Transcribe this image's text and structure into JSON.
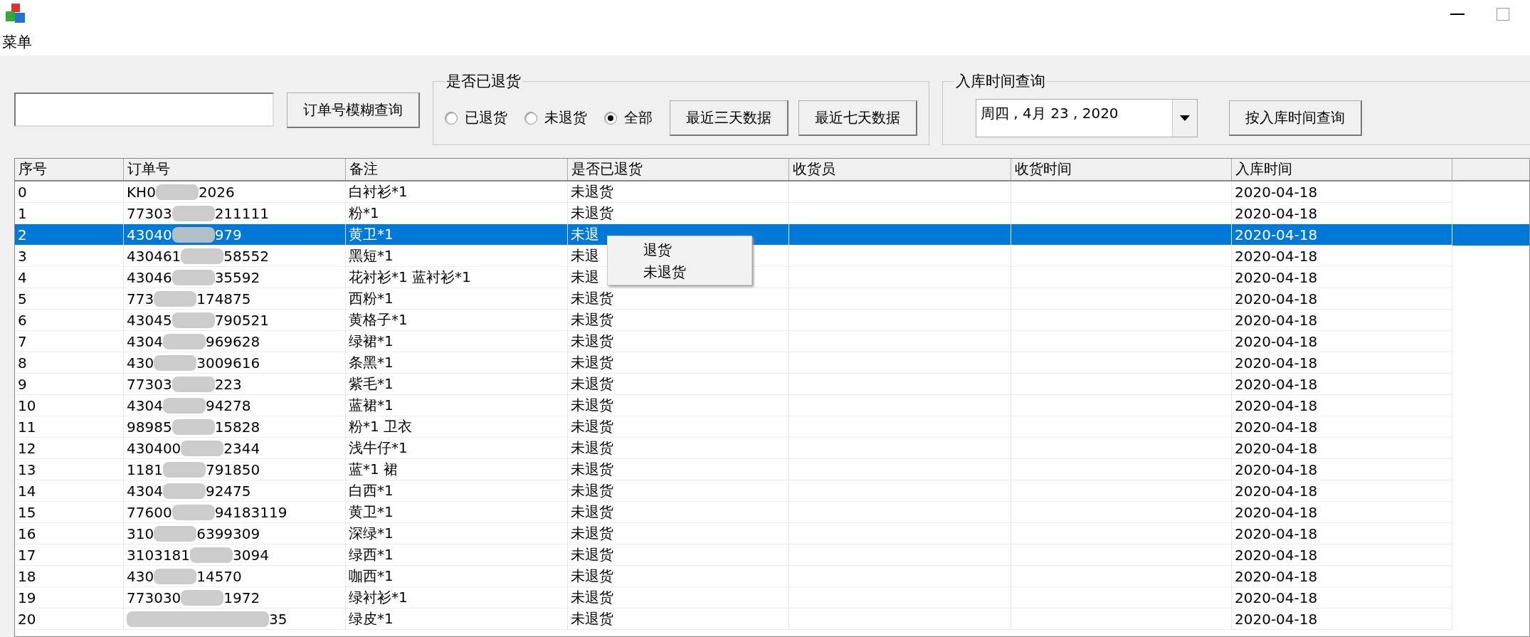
{
  "menu": "菜单",
  "fuzzy_button": "订单号模糊查询",
  "return_group": {
    "title": "是否已退货",
    "radios": [
      {
        "label": "已退货",
        "selected": false
      },
      {
        "label": "未退货",
        "selected": false
      },
      {
        "label": "全部",
        "selected": true
      }
    ],
    "buttons": [
      "最近三天数据",
      "最近七天数据"
    ]
  },
  "date_group": {
    "title": "入库时间查询",
    "date": "周四 , 4月  23 , 2020",
    "button": "按入库时间查询"
  },
  "table": {
    "columns": [
      "序号",
      "订单号",
      "备注",
      "是否已退货",
      "收货员",
      "收货时间",
      "入库时间"
    ],
    "rows": [
      {
        "cells": [
          "0",
          [
            "KH0",
            "2026"
          ],
          "白衬衫*1",
          "未退货",
          "",
          "",
          "2020-04-18"
        ],
        "selected": false
      },
      {
        "cells": [
          "1",
          [
            "77303",
            "211111"
          ],
          "粉*1",
          "未退货",
          "",
          "",
          "2020-04-18"
        ],
        "selected": false
      },
      {
        "cells": [
          "2",
          [
            "43040",
            "979"
          ],
          "黄卫*1",
          "未退",
          "",
          "",
          "2020-04-18"
        ],
        "selected": true
      },
      {
        "cells": [
          "3",
          [
            "430461",
            "58552"
          ],
          "黑短*1",
          "未退",
          "",
          "",
          "2020-04-18"
        ],
        "selected": false
      },
      {
        "cells": [
          "4",
          [
            "43046",
            "35592"
          ],
          "花衬衫*1 蓝衬衫*1",
          "未退",
          "",
          "",
          "2020-04-18"
        ],
        "selected": false
      },
      {
        "cells": [
          "5",
          [
            "773",
            "174875"
          ],
          "西粉*1",
          "未退货",
          "",
          "",
          "2020-04-18"
        ],
        "selected": false
      },
      {
        "cells": [
          "6",
          [
            "43045",
            "790521"
          ],
          "黄格子*1",
          "未退货",
          "",
          "",
          "2020-04-18"
        ],
        "selected": false
      },
      {
        "cells": [
          "7",
          [
            "4304",
            "969628"
          ],
          "绿裙*1",
          "未退货",
          "",
          "",
          "2020-04-18"
        ],
        "selected": false
      },
      {
        "cells": [
          "8",
          [
            "430",
            "3009616"
          ],
          "条黑*1",
          "未退货",
          "",
          "",
          "2020-04-18"
        ],
        "selected": false
      },
      {
        "cells": [
          "9",
          [
            "77303",
            "223"
          ],
          "紫毛*1",
          "未退货",
          "",
          "",
          "2020-04-18"
        ],
        "selected": false
      },
      {
        "cells": [
          "10",
          [
            "4304",
            "94278"
          ],
          "蓝裙*1",
          "未退货",
          "",
          "",
          "2020-04-18"
        ],
        "selected": false
      },
      {
        "cells": [
          "11",
          [
            "98985",
            "15828"
          ],
          "粉*1 卫衣",
          "未退货",
          "",
          "",
          "2020-04-18"
        ],
        "selected": false
      },
      {
        "cells": [
          "12",
          [
            "430400",
            "2344"
          ],
          "浅牛仔*1",
          "未退货",
          "",
          "",
          "2020-04-18"
        ],
        "selected": false
      },
      {
        "cells": [
          "13",
          [
            "1181",
            "791850"
          ],
          "蓝*1 裙",
          "未退货",
          "",
          "",
          "2020-04-18"
        ],
        "selected": false
      },
      {
        "cells": [
          "14",
          [
            "4304",
            "92475"
          ],
          "白西*1",
          "未退货",
          "",
          "",
          "2020-04-18"
        ],
        "selected": false
      },
      {
        "cells": [
          "15",
          [
            "77600",
            "94183119"
          ],
          "黄卫*1",
          "未退货",
          "",
          "",
          "2020-04-18"
        ],
        "selected": false
      },
      {
        "cells": [
          "16",
          [
            "310",
            "6399309"
          ],
          "深绿*1",
          "未退货",
          "",
          "",
          "2020-04-18"
        ],
        "selected": false
      },
      {
        "cells": [
          "17",
          [
            "3103181",
            "3094"
          ],
          "绿西*1",
          "未退货",
          "",
          "",
          "2020-04-18"
        ],
        "selected": false
      },
      {
        "cells": [
          "18",
          [
            "430",
            "14570"
          ],
          "咖西*1",
          "未退货",
          "",
          "",
          "2020-04-18"
        ],
        "selected": false
      },
      {
        "cells": [
          "19",
          [
            "773030",
            "1972"
          ],
          "绿衬衫*1",
          "未退货",
          "",
          "",
          "2020-04-18"
        ],
        "selected": false
      },
      {
        "cells": [
          "20",
          [
            "35"
          ],
          "绿皮*1",
          "未退货",
          "",
          "",
          "2020-04-18"
        ],
        "selected": false
      }
    ]
  },
  "context_menu": [
    "退货",
    "未退货"
  ]
}
